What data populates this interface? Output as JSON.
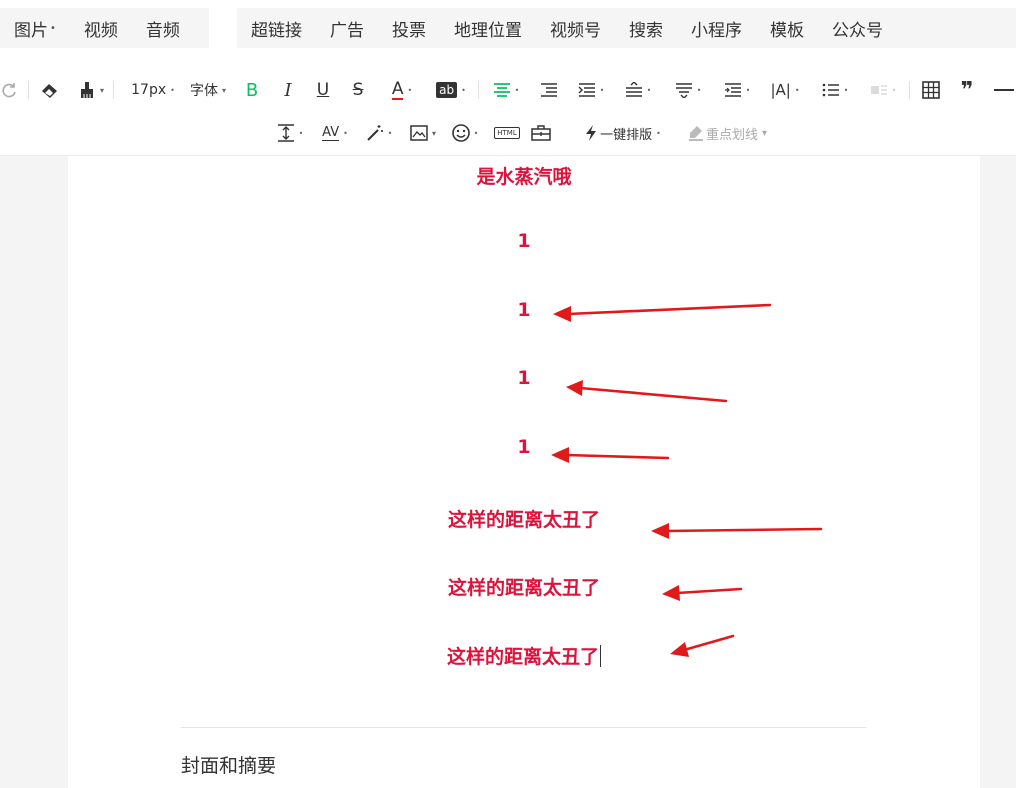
{
  "insert_bar": {
    "group1": [
      {
        "label": "图片",
        "has_menu": true
      },
      {
        "label": "视频",
        "has_menu": false
      },
      {
        "label": "音频",
        "has_menu": false
      }
    ],
    "group2": [
      {
        "label": "超链接"
      },
      {
        "label": "广告"
      },
      {
        "label": "投票"
      },
      {
        "label": "地理位置"
      },
      {
        "label": "视频号"
      },
      {
        "label": "搜索"
      },
      {
        "label": "小程序"
      },
      {
        "label": "模板"
      },
      {
        "label": "公众号"
      }
    ]
  },
  "toolbar": {
    "font_size": "17px",
    "font_family": "字体",
    "bold": "B",
    "italic": "I",
    "underline": "U",
    "strike": "S",
    "font_color": "A",
    "bg_color": "ab",
    "letter_spacing": "AV",
    "html": "HTML",
    "one_click_layout": "一键排版",
    "highlight": "重点划线"
  },
  "colors": {
    "accent_green": "#07c160",
    "content_red": "#dc143c",
    "arrow_red": "#e01a1a"
  },
  "editor": {
    "lines": [
      "是水蒸汽哦",
      "1",
      "1",
      "1",
      "1",
      "这样的距离太丑了",
      "这样的距离太丑了",
      "这样的距离太丑了"
    ],
    "cover_label": "封面和摘要"
  }
}
